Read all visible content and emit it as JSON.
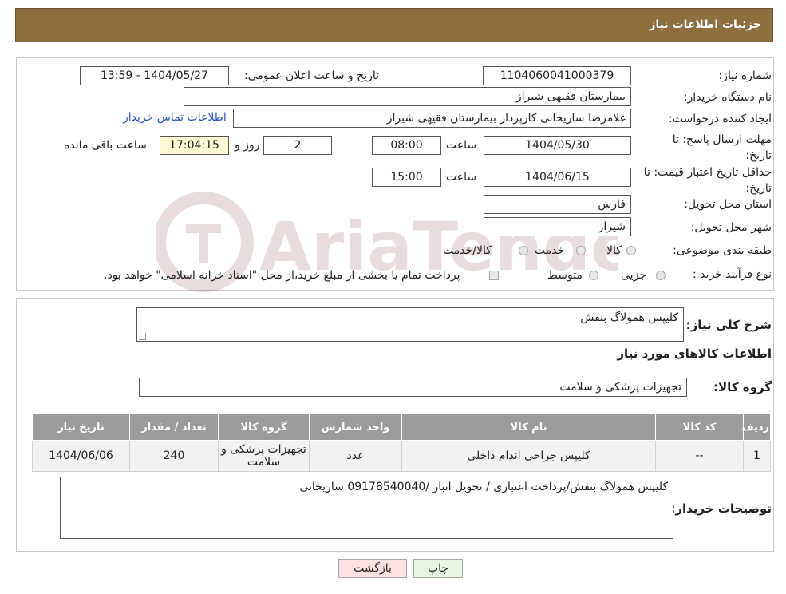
{
  "header": {
    "title": "جزئیات اطلاعات نیاز"
  },
  "form": {
    "need_number_label": "شماره نیاز:",
    "need_number_value": "1104060041000379",
    "announce_datetime_label": "تاریخ و ساعت اعلان عمومی:",
    "announce_datetime_value": "1404/05/27 - 13:59",
    "buyer_org_label": "نام دستگاه خریدار:",
    "buyer_org_value": "بیمارستان فقیهی شیراز",
    "requester_label": "ایجاد کننده درخواست:",
    "requester_value": "غلامرضا ساریخانی کارپرداز بیمارستان فقیهی شیراز",
    "contact_link": "اطلاعات تماس خریدار",
    "deadline_label_line1": "مهلت ارسال پاسخ: تا",
    "deadline_label_line2": "تاریخ:",
    "deadline_date": "1404/05/30",
    "time_label": "ساعت",
    "deadline_time": "08:00",
    "days_value": "2",
    "days_and_label": "روز و",
    "remaining_time": "17:04:15",
    "remaining_label": "ساعت باقی مانده",
    "price_validity_label_line1": "حداقل تاریخ اعتبار قیمت: تا",
    "price_validity_label_line2": "تاریخ:",
    "price_validity_date": "1404/06/15",
    "price_validity_time": "15:00",
    "province_label": "استان محل تحویل:",
    "province_value": "فارس",
    "city_label": "شهر محل تحویل:",
    "city_value": "شیراز",
    "category_label": "طبقه بندی موضوعی:",
    "category_options": [
      "کالا",
      "خدمت",
      "کالا/خدمت"
    ],
    "process_label": "نوع فرآیند خرید :",
    "process_options": [
      "جزیی",
      "متوسط"
    ],
    "process_note": "پرداخت تمام یا بخشی از مبلغ خرید،از محل \"اسناد خزانه اسلامی\" خواهد بود."
  },
  "details": {
    "summary_label": "شرح کلی نیاز:",
    "summary_value": "کلیپس همولاگ بنفش",
    "goods_info_title": "اطلاعات کالاهای مورد نیاز",
    "goods_group_label": "گروه کالا:",
    "goods_group_value": "تجهیزات پزشکی و سلامت",
    "table": {
      "headers": [
        "ردیف",
        "کد کالا",
        "نام کالا",
        "واحد شمارش",
        "گروه کالا",
        "تعداد / مقدار",
        "تاریخ نیاز"
      ],
      "rows": [
        [
          "1",
          "--",
          "کلیپس جراحی اندام داخلی",
          "عدد",
          "تجهیزات پزشکی و سلامت",
          "240",
          "1404/06/06"
        ]
      ]
    },
    "buyer_notes_label": "توضیحات خریدار:",
    "buyer_notes_value": "کلیپس همولاگ بنفش/پرداخت اعتباری / تحویل انبار /09178540040 ساریخانی"
  },
  "buttons": {
    "print": "چاپ",
    "back": "بازگشت"
  },
  "colors": {
    "header_bg": "#8d6e3e",
    "table_header_bg": "#9b9b9b",
    "link": "#2a55c8",
    "back_btn_bg": "#fde0e0",
    "print_btn_bg": "#e6f7df"
  }
}
